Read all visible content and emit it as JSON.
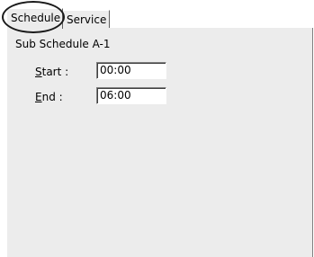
{
  "tabs": [
    {
      "label": "Schedule",
      "active": true
    },
    {
      "label": "Service",
      "active": false
    }
  ],
  "group": {
    "title": "Sub Schedule A-1"
  },
  "fields": {
    "start": {
      "label_accel": "S",
      "label_rest": "tart :",
      "value": "00:00"
    },
    "end": {
      "label_accel": "E",
      "label_rest": "nd :",
      "value": "06:00"
    }
  },
  "colors": {
    "panel_bg": "#ececec",
    "highlight_ring": "#1a1a1a"
  }
}
